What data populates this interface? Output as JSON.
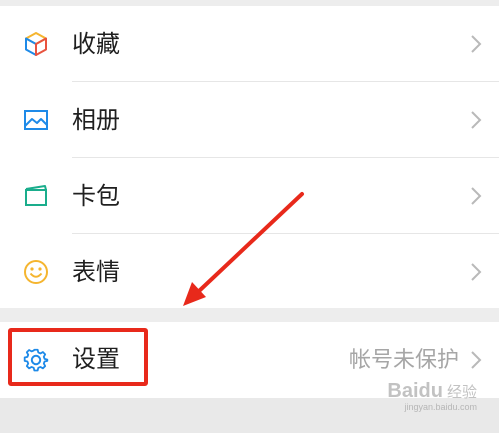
{
  "menu": {
    "items": [
      {
        "label": "收藏",
        "icon": "cube-icon"
      },
      {
        "label": "相册",
        "icon": "image-icon"
      },
      {
        "label": "卡包",
        "icon": "card-icon"
      },
      {
        "label": "表情",
        "icon": "smiley-icon"
      }
    ]
  },
  "settings": {
    "label": "设置",
    "value": "帐号未保护",
    "icon": "gear-icon"
  },
  "watermark": {
    "logo": "Bai",
    "logo_mid": "du",
    "sub": "经验",
    "url": "jingyan.baidu.com"
  },
  "colors": {
    "accent_red": "#e8291b",
    "icon_blue": "#1e8ae8",
    "smiley_yellow": "#f5b52f",
    "card_green": "#1aad8c"
  }
}
